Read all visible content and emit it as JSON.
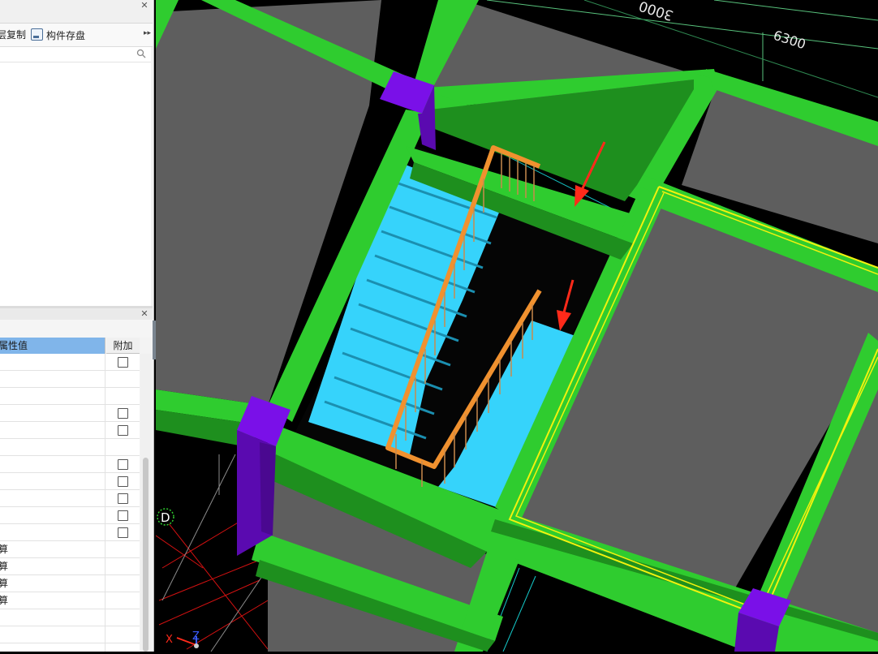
{
  "toolbar": {
    "copy_label": "层复制",
    "save_label": "构件存盘",
    "more_glyph": "▸▸"
  },
  "properties": {
    "header_value": "属性值",
    "header_add": "附加",
    "rows": [
      {
        "value": "",
        "checkbox": true
      },
      {
        "value": "",
        "checkbox": false
      },
      {
        "value": "",
        "checkbox": false
      },
      {
        "value": "",
        "checkbox": true
      },
      {
        "value": "",
        "checkbox": true
      },
      {
        "value": "",
        "checkbox": false
      },
      {
        "value": "",
        "checkbox": true
      },
      {
        "value": "",
        "checkbox": true
      },
      {
        "value": "",
        "checkbox": true
      },
      {
        "value": "",
        "checkbox": true
      },
      {
        "value": "",
        "checkbox": true
      },
      {
        "value": "算",
        "checkbox": false
      },
      {
        "value": "算",
        "checkbox": false
      },
      {
        "value": "算",
        "checkbox": false
      },
      {
        "value": "算",
        "checkbox": false
      },
      {
        "value": "",
        "checkbox": false
      },
      {
        "value": "",
        "checkbox": false
      },
      {
        "value": "",
        "checkbox": false
      }
    ]
  },
  "viewport": {
    "dimension_1": "3000",
    "dimension_2": "6300",
    "axis_marker": "D",
    "axis_x": "X",
    "axis_z": "Z",
    "colors": {
      "beam": "#2fcc2f",
      "column": "#7a10e8",
      "slab": "#5e5e5e",
      "stair": "#36d3fb",
      "railing": "#f0912f",
      "arrow": "#ff2a1a",
      "outline": "#f2f20e"
    }
  }
}
